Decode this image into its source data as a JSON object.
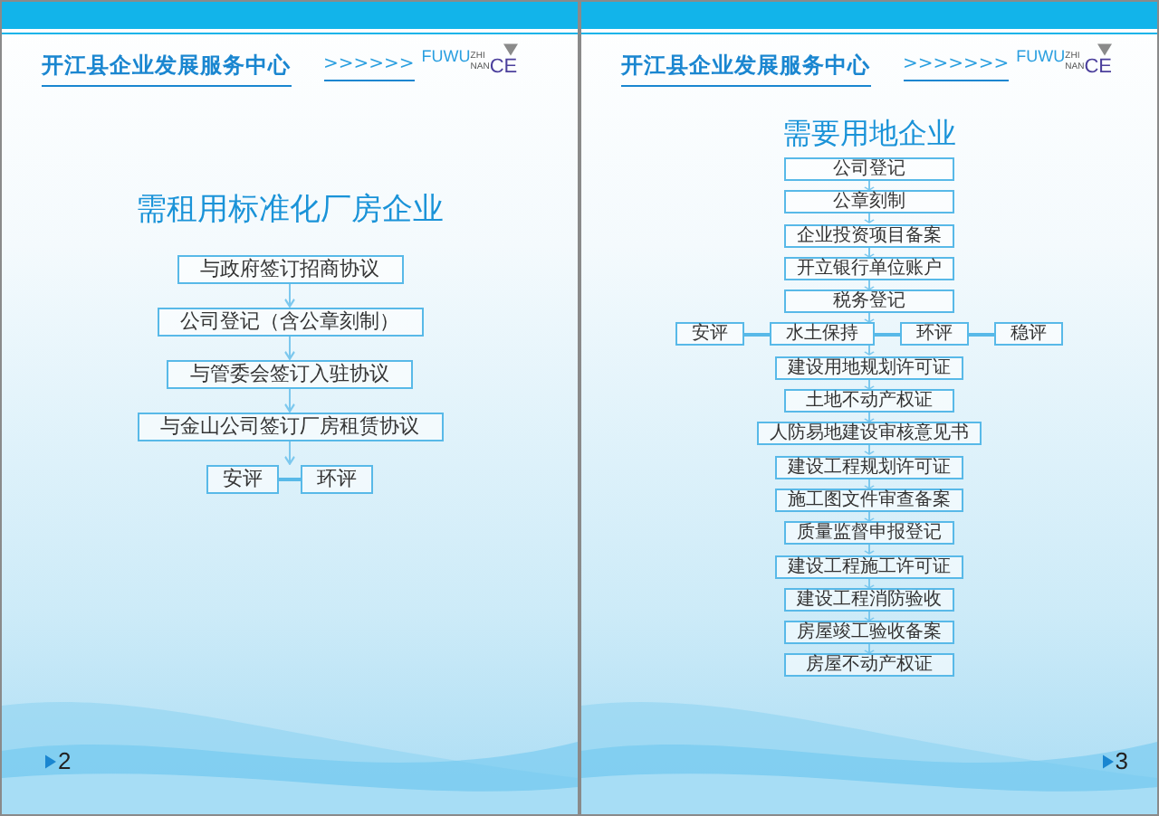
{
  "pages": [
    {
      "header": {
        "title": "开江县企业发展服务中心",
        "chevrons": ">>>>>>",
        "logo": {
          "main": "FUWU",
          "sup": "ZHI",
          "sub": "NAN",
          "bottom": "CE"
        }
      },
      "heading": "需租用标准化厂房企业",
      "page_number": "2",
      "flow": [
        {
          "kind": "step",
          "label": "与政府签订招商协议"
        },
        {
          "kind": "step",
          "label": "公司登记（含公章刻制）"
        },
        {
          "kind": "step",
          "label": "与管委会签订入驻协议"
        },
        {
          "kind": "step",
          "label": "与金山公司签订厂房租赁协议"
        },
        {
          "kind": "branch",
          "items": [
            "安评",
            "环评"
          ]
        }
      ]
    },
    {
      "header": {
        "title": "开江县企业发展服务中心",
        "chevrons": ">>>>>>>",
        "logo": {
          "main": "FUWU",
          "sup": "ZHI",
          "sub": "NAN",
          "bottom": "CE"
        }
      },
      "heading": "需要用地企业",
      "page_number": "3",
      "flow": [
        {
          "kind": "step",
          "label": "公司登记"
        },
        {
          "kind": "step",
          "label": "公章刻制"
        },
        {
          "kind": "step",
          "label": "企业投资项目备案"
        },
        {
          "kind": "step",
          "label": "开立银行单位账户"
        },
        {
          "kind": "step",
          "label": "税务登记"
        },
        {
          "kind": "branch",
          "items": [
            "安评",
            "水土保持",
            "环评",
            "稳评"
          ]
        },
        {
          "kind": "step",
          "label": "建设用地规划许可证"
        },
        {
          "kind": "step",
          "label": "土地不动产权证"
        },
        {
          "kind": "step",
          "label": "人防易地建设审核意见书"
        },
        {
          "kind": "step",
          "label": "建设工程规划许可证"
        },
        {
          "kind": "step",
          "label": "施工图文件审查备案"
        },
        {
          "kind": "step",
          "label": "质量监督申报登记"
        },
        {
          "kind": "step",
          "label": "建设工程施工许可证"
        },
        {
          "kind": "step",
          "label": "建设工程消防验收"
        },
        {
          "kind": "step",
          "label": "房屋竣工验收备案"
        },
        {
          "kind": "step",
          "label": "房屋不动产权证"
        }
      ]
    }
  ]
}
